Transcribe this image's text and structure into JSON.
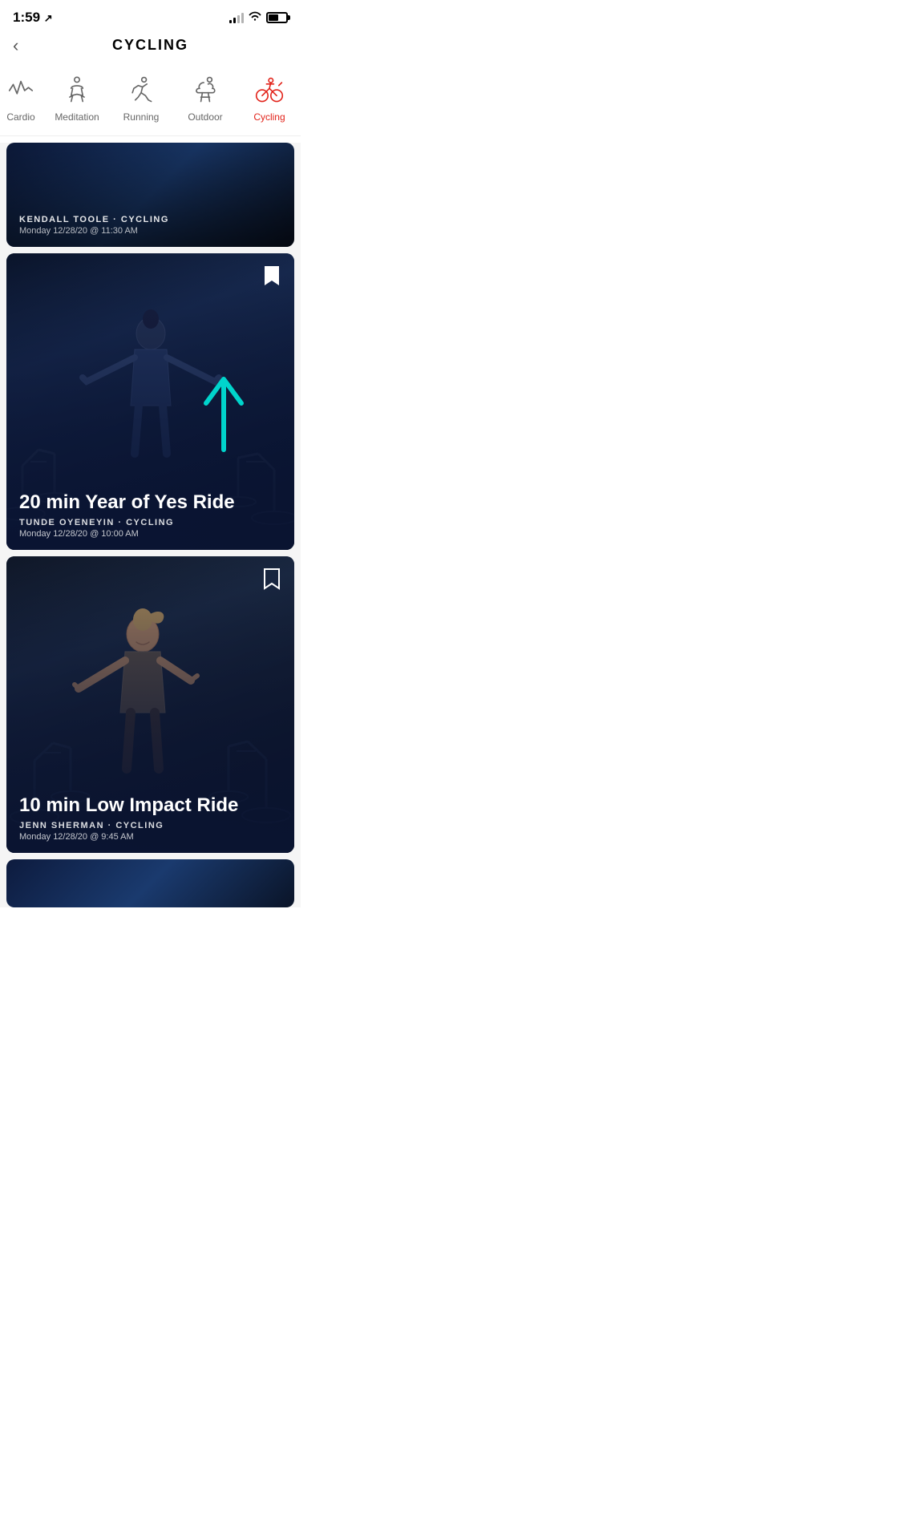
{
  "statusBar": {
    "time": "1:59",
    "timeSymbol": "↗"
  },
  "header": {
    "backLabel": "<",
    "title": "CYCLING"
  },
  "categories": [
    {
      "id": "cardio",
      "label": "Cardio",
      "icon": "cardio",
      "active": false,
      "partial": true
    },
    {
      "id": "meditation",
      "label": "Meditation",
      "icon": "meditation",
      "active": false
    },
    {
      "id": "running",
      "label": "Running",
      "icon": "running",
      "active": false
    },
    {
      "id": "outdoor",
      "label": "Outdoor",
      "icon": "outdoor",
      "active": false
    },
    {
      "id": "cycling",
      "label": "Cycling",
      "icon": "cycling",
      "active": true
    }
  ],
  "cards": [
    {
      "id": "card1",
      "partial": true,
      "instructor": "KENDALL TOOLE",
      "category": "CYCLING",
      "date": "Monday 12/28/20 @ 11:30 AM",
      "title": null,
      "bookmarked": false
    },
    {
      "id": "card2",
      "partial": false,
      "title": "20 min Year of Yes Ride",
      "instructor": "TUNDE OYENEYIN",
      "category": "CYCLING",
      "date": "Monday 12/28/20 @ 10:00 AM",
      "bookmarked": true,
      "hasArrow": true
    },
    {
      "id": "card3",
      "partial": false,
      "title": "10 min Low Impact Ride",
      "instructor": "JENN SHERMAN",
      "category": "CYCLING",
      "date": "Monday 12/28/20 @ 9:45 AM",
      "bookmarked": false
    }
  ],
  "colors": {
    "active": "#e2231a",
    "inactive": "#666",
    "teal": "#00c8c8",
    "cardBg1": "#0d1b3e",
    "cardBg2": "#0f1e40",
    "white": "#ffffff"
  }
}
